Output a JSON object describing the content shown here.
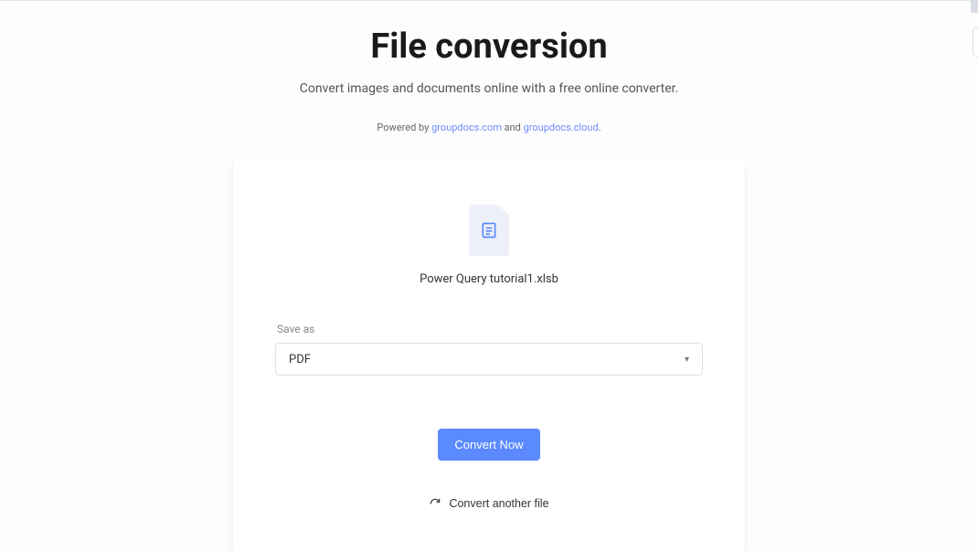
{
  "header": {
    "title": "File conversion",
    "subtitle": "Convert images and documents online with a free online converter.",
    "powered_prefix": "Powered by ",
    "powered_link1": "groupdocs.com",
    "powered_and": " and ",
    "powered_link2": "groupdocs.cloud",
    "powered_suffix": "."
  },
  "file": {
    "name": "Power Query tutorial1.xlsb"
  },
  "save_as": {
    "label": "Save as",
    "selected": "PDF"
  },
  "actions": {
    "convert": "Convert Now",
    "another": "Convert another file"
  }
}
